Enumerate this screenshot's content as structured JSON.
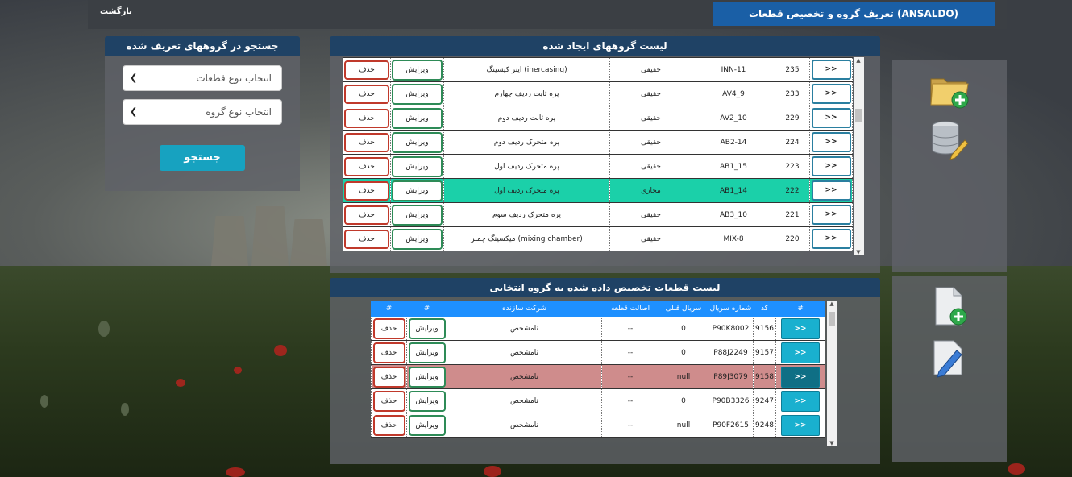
{
  "topbar": {
    "back_label": "بازگشت",
    "title": "تعریف گروه و تخصیص قطعات (ANSALDO)"
  },
  "search": {
    "title": "جستجو در گروههای تعریف شده",
    "part_type_placeholder": "انتخاب نوع قطعات",
    "group_type_placeholder": "انتخاب نوع گروه",
    "button_label": "جستجو"
  },
  "groups": {
    "title": "لیست گروههای ایجاد شده",
    "delete_label": "حذف",
    "edit_label": "ویرایش",
    "go_label": ">>",
    "rows": [
      {
        "name": "اینر کیسینگ (inercasing)",
        "type": "حقیقی",
        "code": "INN-11",
        "id": "235"
      },
      {
        "name": "پره ثابت ردیف چهارم",
        "type": "حقیقی",
        "code": "AV4_9",
        "id": "233"
      },
      {
        "name": "پره ثابت ردیف دوم",
        "type": "حقیقی",
        "code": "AV2_10",
        "id": "229"
      },
      {
        "name": "پره متحرک ردیف دوم",
        "type": "حقیقی",
        "code": "AB2-14",
        "id": "224"
      },
      {
        "name": "پره متحرک ردیف اول",
        "type": "حقیقی",
        "code": "AB1_15",
        "id": "223"
      },
      {
        "name": "پره متحرک ردیف اول",
        "type": "مجازی",
        "code": "AB1_14",
        "id": "222"
      },
      {
        "name": "پره متحرک ردیف سوم",
        "type": "حقیقی",
        "code": "AB3_10",
        "id": "221"
      },
      {
        "name": "میکسینگ چمبر (mixing chamber)",
        "type": "حقیقی",
        "code": "MIX-8",
        "id": "220"
      }
    ]
  },
  "parts": {
    "title": "لیست قطعات تخصیص داده شده به گروه انتخابی",
    "headers": {
      "hash1": "#",
      "hash2": "#",
      "maker": "شرکت سازنده",
      "origin": "اصالت قطعه",
      "prev_serial": "سریال قبلی",
      "serial": "شماره سریال",
      "code": "کد",
      "hash3": "#"
    },
    "delete_label": "حذف",
    "edit_label": "ویرایش",
    "go_label": ">>",
    "rows": [
      {
        "maker": "نامشخص",
        "origin": "--",
        "prev": "0",
        "serial": "P90K8002",
        "code": "9156"
      },
      {
        "maker": "نامشخص",
        "origin": "--",
        "prev": "0",
        "serial": "P88J2249",
        "code": "9157"
      },
      {
        "maker": "نامشخص",
        "origin": "--",
        "prev": "null",
        "serial": "P89J3079",
        "code": "9158"
      },
      {
        "maker": "نامشخص",
        "origin": "--",
        "prev": "0",
        "serial": "P90B3326",
        "code": "9247"
      },
      {
        "maker": "نامشخص",
        "origin": "--",
        "prev": "null",
        "serial": "P90F2615",
        "code": "9248"
      }
    ]
  },
  "colors": {
    "selected_group": "#1bd0a9",
    "selected_part": "#cf8c8c",
    "header_blue": "#1f4265",
    "title_blue": "#1a5fa6"
  },
  "icons": [
    "folder-add-icon",
    "database-edit-icon",
    "document-add-icon",
    "document-edit-icon"
  ]
}
